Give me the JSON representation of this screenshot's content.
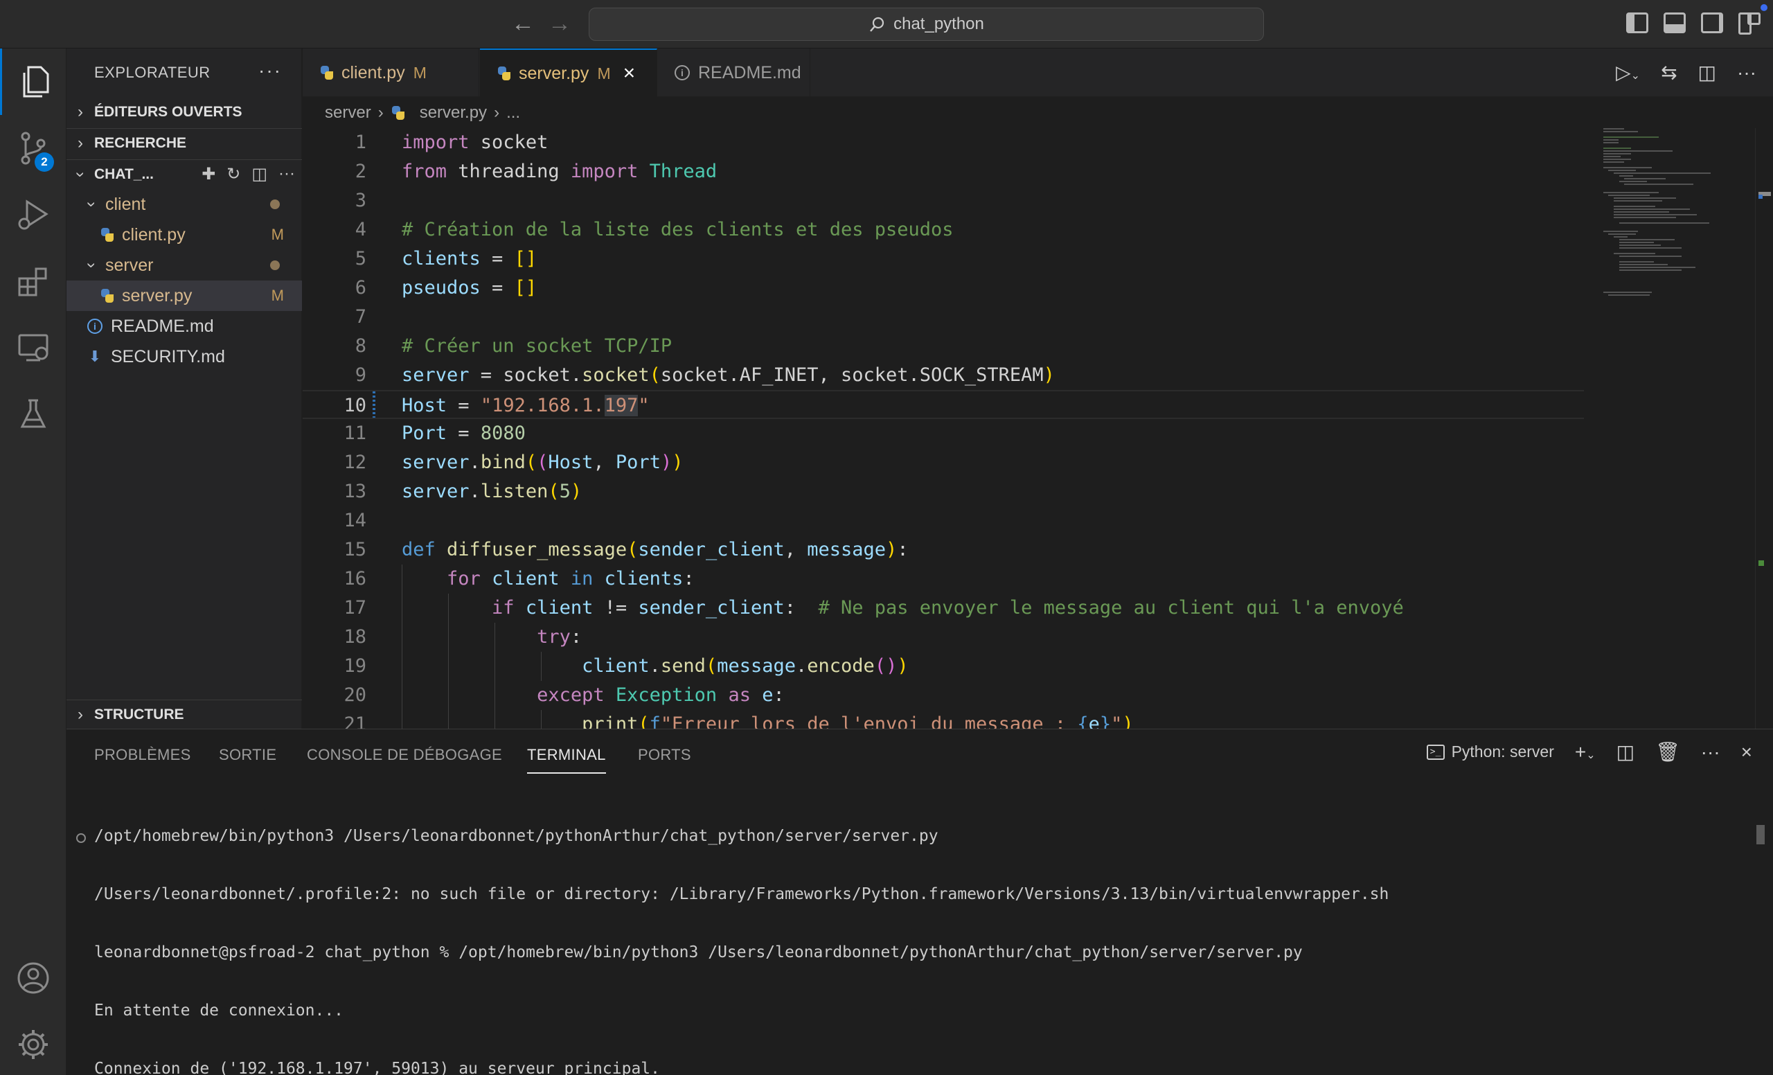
{
  "titlebar": {
    "search_text": "chat_python",
    "back_icon": "arrow-left-icon",
    "forward_icon": "arrow-right-icon"
  },
  "activity_bar": {
    "items": [
      {
        "name": "explorer",
        "icon": "files-icon"
      },
      {
        "name": "source-control",
        "icon": "source-control-icon",
        "badge": "2"
      },
      {
        "name": "run-debug",
        "icon": "run-debug-icon"
      },
      {
        "name": "extensions",
        "icon": "extensions-icon"
      },
      {
        "name": "remote-explorer",
        "icon": "remote-icon"
      },
      {
        "name": "testing",
        "icon": "flask-icon"
      }
    ],
    "bottom": [
      {
        "name": "accounts",
        "icon": "account-icon"
      },
      {
        "name": "manage",
        "icon": "gear-icon"
      }
    ]
  },
  "sidebar": {
    "title": "EXPLORATEUR",
    "more": "···",
    "sections": {
      "open_editors": "ÉDITEURS OUVERTS",
      "search": "RECHERCHE",
      "workspace": "CHAT_...",
      "outline": "STRUCTURE"
    },
    "tree": [
      {
        "label": "client",
        "type": "folder",
        "status_dot": true
      },
      {
        "label": "client.py",
        "type": "python",
        "status": "M"
      },
      {
        "label": "server",
        "type": "folder",
        "status_dot": true
      },
      {
        "label": "server.py",
        "type": "python",
        "status": "M",
        "selected": true
      },
      {
        "label": "README.md",
        "type": "info"
      },
      {
        "label": "SECURITY.md",
        "type": "download"
      }
    ]
  },
  "tabs": [
    {
      "label": "client.py",
      "modified": "M"
    },
    {
      "label": "server.py",
      "modified": "M",
      "active": true
    },
    {
      "label": "README.md"
    }
  ],
  "breadcrumb": {
    "folder": "server",
    "file": "server.py",
    "more": "..."
  },
  "editor": {
    "current_line": 10,
    "lines": [
      "1",
      "2",
      "3",
      "4",
      "5",
      "6",
      "7",
      "8",
      "9",
      "10",
      "11",
      "12",
      "13",
      "14",
      "15",
      "16",
      "17",
      "18",
      "19",
      "20",
      "21"
    ]
  },
  "panel": {
    "tabs": [
      "PROBLÈMES",
      "SORTIE",
      "CONSOLE DE DÉBOGAGE",
      "TERMINAL",
      "PORTS"
    ],
    "active_tab": "TERMINAL",
    "terminal_name": "Python: server",
    "output": [
      "/opt/homebrew/bin/python3 /Users/leonardbonnet/pythonArthur/chat_python/server/server.py",
      "/Users/leonardbonnet/.profile:2: no such file or directory: /Library/Frameworks/Python.framework/Versions/3.13/bin/virtualenvwrapper.sh",
      "leonardbonnet@psfroad-2 chat_python % /opt/homebrew/bin/python3 /Users/leonardbonnet/pythonArthur/chat_python/server/server.py",
      "En attente de connexion...",
      "Connexion de ('192.168.1.197', 59013) au serveur principal."
    ]
  },
  "colors": {
    "accent": "#0078d4",
    "modified": "#c19a5b"
  }
}
